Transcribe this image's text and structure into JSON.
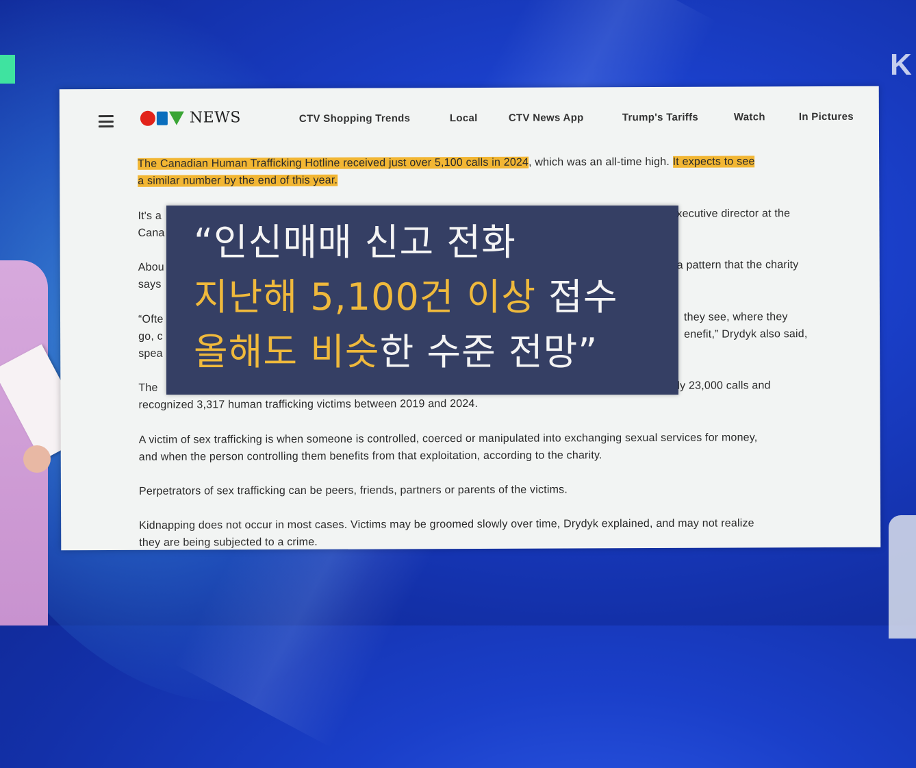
{
  "broadcast": {
    "channel_logo": "K"
  },
  "article": {
    "site_logo": {
      "c": "C",
      "t": "T",
      "v": "V",
      "text": "NEWS"
    },
    "nav": [
      "CTV Shopping Trends",
      "Local",
      "CTV News App",
      "Trump's Tariffs",
      "Watch",
      "In Pictures"
    ],
    "p1": {
      "hl1": "The Canadian Human Trafficking Hotline received just over 5,100 calls in 2024",
      "plain": ", which was an all-time high. ",
      "hl2a": "It expects to see",
      "hl2b": "a similar number by the end of this year."
    },
    "p2": {
      "l1_left": "It's a",
      "l1_right": "xecutive director at the",
      "l2_left": "Cana"
    },
    "p3": {
      "l1_left": "Abou",
      "l1_right": "a pattern that the charity",
      "l2_left": "says"
    },
    "p4": {
      "l1_left": "“Ofte",
      "l1_right": "they see, where they",
      "l2_left": "go, c",
      "l2_right": "enefit,” Drydyk also said,",
      "l3_left": "spea"
    },
    "p5": {
      "l1_left": "The",
      "l1_right": "ly 23,000 calls and",
      "l2": "recognized 3,317 human trafficking victims between 2019 and 2024."
    },
    "p6": {
      "l1": "A victim of sex trafficking is when someone is controlled, coerced or manipulated into exchanging sexual services for money,",
      "l2": "and when the person controlling them benefits from that exploitation, according to the charity."
    },
    "p7": "Perpetrators of sex trafficking can be peers, friends, partners or parents of the victims.",
    "p8": {
      "l1": "Kidnapping does not occur in most cases. Victims may be groomed slowly over time, Drydyk explained, and may not realize",
      "l2": "they are being subjected to a crime."
    }
  },
  "caption": {
    "line1": "“인신매매 신고 전화",
    "line2_gold": "지난해 5,100건 이상",
    "line2_white": " 접수",
    "line3_gold": "올해도 비슷",
    "line3_white": "한 수준 전망”"
  },
  "colors": {
    "highlight": "#f2b633",
    "caption_gold": "#efb93c",
    "caption_bg": "#1a2650"
  }
}
